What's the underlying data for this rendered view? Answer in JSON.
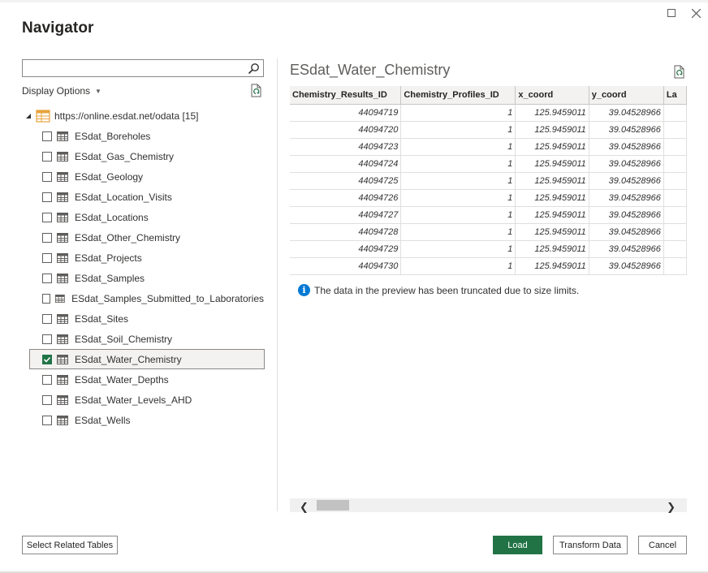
{
  "window": {
    "title": "Navigator",
    "maximize_label": "□",
    "close_label": "✕"
  },
  "left": {
    "search_placeholder": "",
    "display_options_label": "Display Options",
    "root_label": "https://online.esdat.net/odata [15]",
    "items": [
      {
        "label": "ESdat_Boreholes",
        "checked": false
      },
      {
        "label": "ESdat_Gas_Chemistry",
        "checked": false
      },
      {
        "label": "ESdat_Geology",
        "checked": false
      },
      {
        "label": "ESdat_Location_Visits",
        "checked": false
      },
      {
        "label": "ESdat_Locations",
        "checked": false
      },
      {
        "label": "ESdat_Other_Chemistry",
        "checked": false
      },
      {
        "label": "ESdat_Projects",
        "checked": false
      },
      {
        "label": "ESdat_Samples",
        "checked": false
      },
      {
        "label": "ESdat_Samples_Submitted_to_Laboratories",
        "checked": false
      },
      {
        "label": "ESdat_Sites",
        "checked": false
      },
      {
        "label": "ESdat_Soil_Chemistry",
        "checked": false
      },
      {
        "label": "ESdat_Water_Chemistry",
        "checked": true
      },
      {
        "label": "ESdat_Water_Depths",
        "checked": false
      },
      {
        "label": "ESdat_Water_Levels_AHD",
        "checked": false
      },
      {
        "label": "ESdat_Wells",
        "checked": false
      }
    ]
  },
  "preview": {
    "title": "ESdat_Water_Chemistry",
    "columns": [
      "Chemistry_Results_ID",
      "Chemistry_Profiles_ID",
      "x_coord",
      "y_coord",
      "La"
    ],
    "rows": [
      [
        "44094719",
        "1",
        "125.9459011",
        "39.04528966",
        ""
      ],
      [
        "44094720",
        "1",
        "125.9459011",
        "39.04528966",
        ""
      ],
      [
        "44094723",
        "1",
        "125.9459011",
        "39.04528966",
        ""
      ],
      [
        "44094724",
        "1",
        "125.9459011",
        "39.04528966",
        ""
      ],
      [
        "44094725",
        "1",
        "125.9459011",
        "39.04528966",
        ""
      ],
      [
        "44094726",
        "1",
        "125.9459011",
        "39.04528966",
        ""
      ],
      [
        "44094727",
        "1",
        "125.9459011",
        "39.04528966",
        ""
      ],
      [
        "44094728",
        "1",
        "125.9459011",
        "39.04528966",
        ""
      ],
      [
        "44094729",
        "1",
        "125.9459011",
        "39.04528966",
        ""
      ],
      [
        "44094730",
        "1",
        "125.9459011",
        "39.04528966",
        ""
      ]
    ],
    "truncated_message": "The data in the preview has been truncated due to size limits.",
    "info_glyph": "i",
    "scroll_left_glyph": "❮",
    "scroll_right_glyph": "❯"
  },
  "footer": {
    "select_related_label": "Select Related Tables",
    "load_label": "Load",
    "transform_label": "Transform Data",
    "cancel_label": "Cancel"
  },
  "colors": {
    "accent": "#217346",
    "info": "#0078d4",
    "border": "#8a8886"
  }
}
